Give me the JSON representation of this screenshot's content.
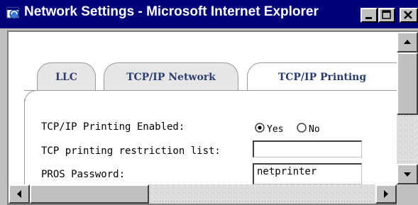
{
  "window": {
    "title": "Network Settings - Microsoft Internet Explorer",
    "icon": "ie-icon",
    "controls": [
      "minimize-icon",
      "maximize-icon",
      "close-icon"
    ]
  },
  "tabs": [
    {
      "label": "LLC",
      "active": false
    },
    {
      "label": "TCP/IP Network",
      "active": false
    },
    {
      "label": "TCP/IP Printing",
      "active": true
    }
  ],
  "form": {
    "printing_enabled": {
      "label": "TCP/IP Printing Enabled:",
      "options": [
        {
          "label": "Yes",
          "selected": true
        },
        {
          "label": "No",
          "selected": false
        }
      ]
    },
    "restriction_list": {
      "label": "TCP printing restriction list:",
      "value": ""
    },
    "pros_password": {
      "label": "PROS Password:",
      "value": "netprinter"
    }
  },
  "colors": {
    "titlebar": "#00007b",
    "face": "#c0c0c0",
    "tab_text": "#2c3e6e",
    "tab_border": "#9a9a9a"
  }
}
